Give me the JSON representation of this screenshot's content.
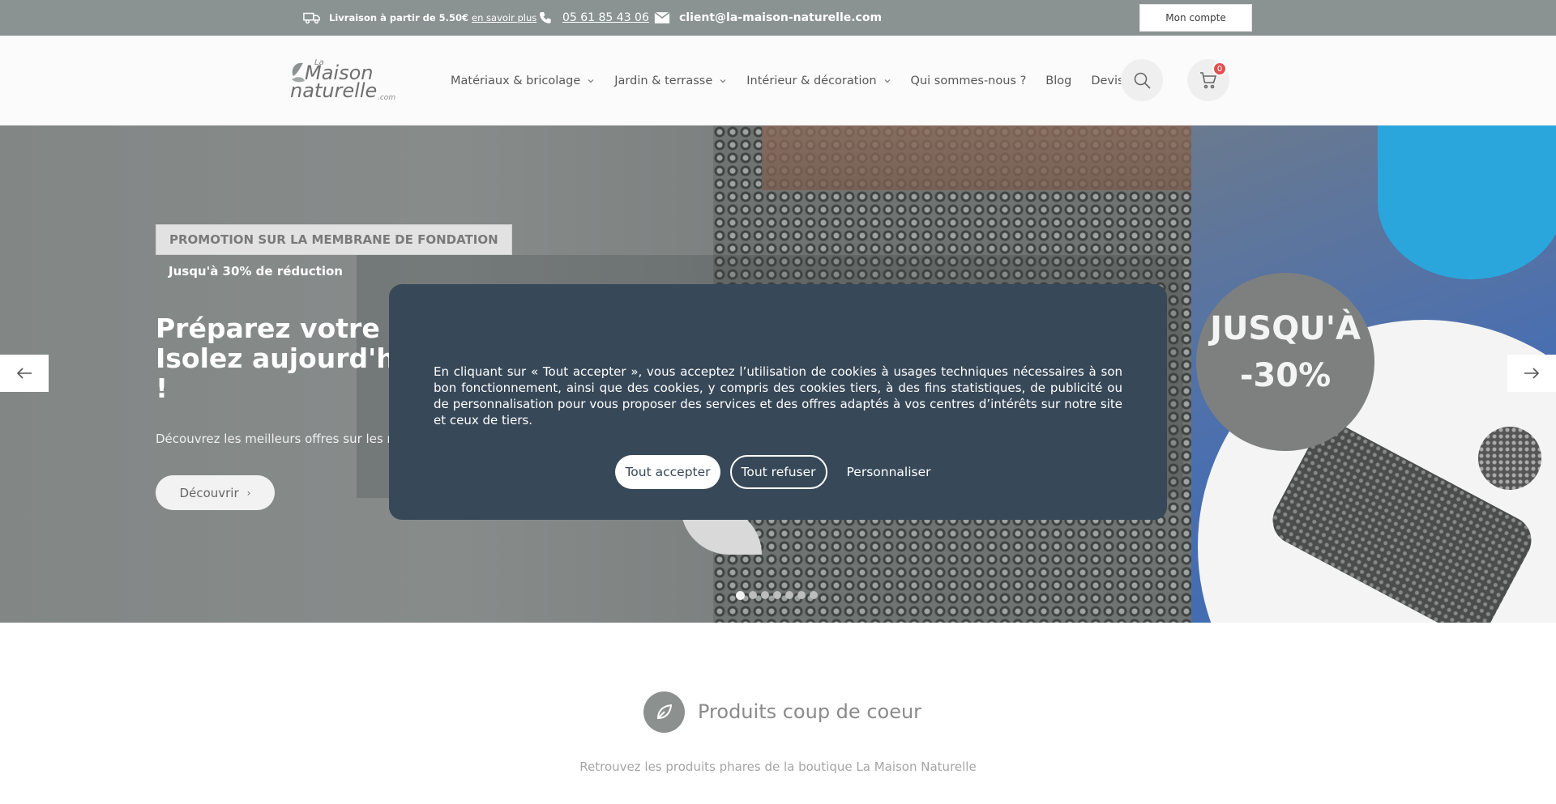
{
  "topbar": {
    "delivery_text": "Livraison à partir de 5.50€",
    "delivery_link": "en savoir plus",
    "phone": "05 61 85 43 06",
    "email": "client@la-maison-naturelle.com",
    "account_button": "Mon compte"
  },
  "header": {
    "logo": {
      "line1": "La",
      "line2": "Maison",
      "line3": "naturelle",
      "suffix": ".com"
    },
    "nav": [
      {
        "label": "Matériaux & bricolage",
        "has_dropdown": true
      },
      {
        "label": "Jardin & terrasse",
        "has_dropdown": true
      },
      {
        "label": "Intérieur & décoration",
        "has_dropdown": true
      },
      {
        "label": "Qui sommes-nous ?",
        "has_dropdown": false
      },
      {
        "label": "Blog",
        "has_dropdown": false
      },
      {
        "label": "Devis",
        "has_dropdown": false
      }
    ],
    "cart_count": "0"
  },
  "hero": {
    "badge": "PROMOTION SUR LA MEMBRANE DE FONDATION",
    "subbadge": "Jusqu'à 30% de réduction",
    "title_line1": "Préparez votre con",
    "title_line2": "Isolez aujourd'hui,",
    "title_line3": "!",
    "description": "Découvrez les meilleurs offres sur les m",
    "cta": "Découvrir",
    "promo_line1": "JUSQU'À",
    "promo_line2": "-30%",
    "slide_count": 7,
    "active_slide": 1
  },
  "section": {
    "title": "Produits coup de coeur",
    "subtitle": "Retrouvez les produits phares de la boutique La Maison Naturelle"
  },
  "cookie": {
    "icon_glyph": "",
    "text": "En cliquant sur « Tout accepter », vous acceptez l’utilisation de cookies à usages techniques nécessaires à son bon fonctionnement, ainsi que des cookies, y compris des cookies tiers, à des fins statistiques, de publicité ou de personnalisation pour vous proposer des services et des offres adaptés à vos centres d’intérêts sur notre site et ceux de tiers.",
    "accept": "Tout accepter",
    "refuse": "Tout refuser",
    "customize": "Personnaliser"
  },
  "colors": {
    "topbar": "#8a9391",
    "modal": "#374858",
    "cart_badge": "#e15050"
  }
}
